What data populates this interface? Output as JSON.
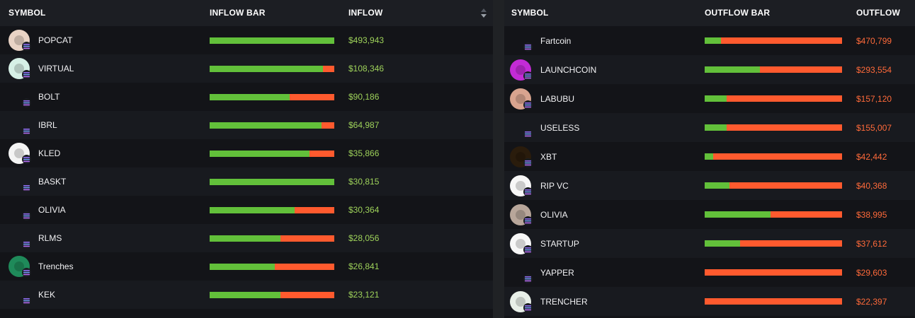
{
  "colors": {
    "inflow_green": "#62c03a",
    "outflow_red": "#ff5a2e",
    "inflow_text": "#9ed25a",
    "outflow_text": "#ff6a3a",
    "panel_bg": "#131418",
    "header_bg": "#1c1e23"
  },
  "inflow_table": {
    "headers": {
      "symbol": "SYMBOL",
      "bar": "INFLOW BAR",
      "value": "INFLOW"
    },
    "sort_icon": "sort-arrows-icon",
    "rows": [
      {
        "symbol": "POPCAT",
        "inflow_share": 1.0,
        "amount": "$493,943",
        "avatar": "cat-logo",
        "avatar_color": "#e9d3c5"
      },
      {
        "symbol": "VIRTUAL",
        "inflow_share": 0.91,
        "amount": "$108,346",
        "avatar": "virtual-logo",
        "avatar_color": "#d6f0e6"
      },
      {
        "symbol": "BOLT",
        "inflow_share": 0.64,
        "amount": "$90,186",
        "avatar": "none",
        "avatar_color": ""
      },
      {
        "symbol": "IBRL",
        "inflow_share": 0.9,
        "amount": "$64,987",
        "avatar": "none",
        "avatar_color": ""
      },
      {
        "symbol": "KLED",
        "inflow_share": 0.8,
        "amount": "$35,866",
        "avatar": "wave-logo",
        "avatar_color": "#f4f4f4"
      },
      {
        "symbol": "BASKT",
        "inflow_share": 1.0,
        "amount": "$30,815",
        "avatar": "none",
        "avatar_color": ""
      },
      {
        "symbol": "OLIVIA",
        "inflow_share": 0.68,
        "amount": "$30,364",
        "avatar": "none",
        "avatar_color": ""
      },
      {
        "symbol": "RLMS",
        "inflow_share": 0.57,
        "amount": "$28,056",
        "avatar": "none",
        "avatar_color": ""
      },
      {
        "symbol": "Trenches",
        "inflow_share": 0.52,
        "amount": "$26,841",
        "avatar": "trenches-logo",
        "avatar_color": "#1f8a5a"
      },
      {
        "symbol": "KEK",
        "inflow_share": 0.57,
        "amount": "$23,121",
        "avatar": "none",
        "avatar_color": ""
      }
    ]
  },
  "outflow_table": {
    "headers": {
      "symbol": "SYMBOL",
      "bar": "OUTFLOW BAR",
      "value": "OUTFLOW"
    },
    "rows": [
      {
        "symbol": "Fartcoin",
        "inflow_share": 0.12,
        "amount": "$470,799",
        "avatar": "none",
        "avatar_color": ""
      },
      {
        "symbol": "LAUNCHCOIN",
        "inflow_share": 0.4,
        "amount": "$293,554",
        "avatar": "launchcoin-logo",
        "avatar_color": "#c32bd6"
      },
      {
        "symbol": "LABUBU",
        "inflow_share": 0.16,
        "amount": "$157,120",
        "avatar": "labubu-logo",
        "avatar_color": "#d9a48f"
      },
      {
        "symbol": "USELESS",
        "inflow_share": 0.16,
        "amount": "$155,007",
        "avatar": "none",
        "avatar_color": ""
      },
      {
        "symbol": "XBT",
        "inflow_share": 0.06,
        "amount": "$42,442",
        "avatar": "xbt-logo",
        "avatar_color": "#2a1c0c"
      },
      {
        "symbol": "RIP VC",
        "inflow_share": 0.18,
        "amount": "$40,368",
        "avatar": "ripvc-logo",
        "avatar_color": "#f7f7f7"
      },
      {
        "symbol": "OLIVIA",
        "inflow_share": 0.48,
        "amount": "$38,995",
        "avatar": "olivia-logo",
        "avatar_color": "#b8a69a"
      },
      {
        "symbol": "STARTUP",
        "inflow_share": 0.26,
        "amount": "$37,612",
        "avatar": "startup-logo",
        "avatar_color": "#f7f7f7"
      },
      {
        "symbol": "YAPPER",
        "inflow_share": 0.0,
        "amount": "$29,603",
        "avatar": "none",
        "avatar_color": ""
      },
      {
        "symbol": "TRENCHER",
        "inflow_share": 0.0,
        "amount": "$22,397",
        "avatar": "trencher-logo",
        "avatar_color": "#e8efe8"
      }
    ]
  }
}
